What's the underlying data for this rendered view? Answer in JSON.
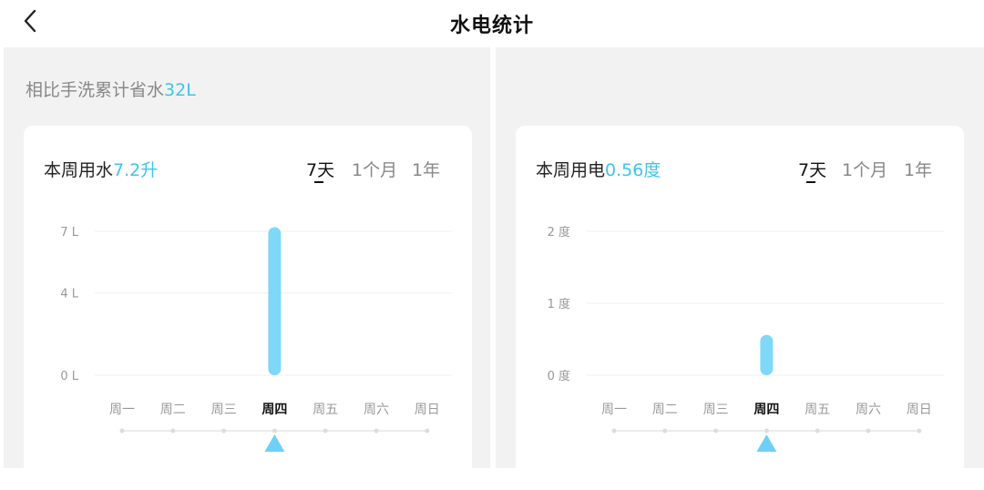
{
  "header": {
    "title": "水电统计",
    "back_icon": "chevron-left-icon"
  },
  "water": {
    "summary_prefix": "相比手洗累计省水",
    "summary_value": "32L",
    "card_title_prefix": "本周用水",
    "card_title_value": "7.2升",
    "ranges": [
      "7天",
      "1个月",
      "1年"
    ],
    "active_range": "7天"
  },
  "power": {
    "card_title_prefix": "本周用电",
    "card_title_value": "0.56度",
    "ranges": [
      "7天",
      "1个月",
      "1年"
    ],
    "active_range": "7天"
  },
  "colors": {
    "accent": "#3fc4e8",
    "bar": "#7fd8f7",
    "indicator": "#6fd0f5"
  },
  "chart_data": [
    {
      "type": "bar",
      "categories": [
        "周一",
        "周二",
        "周三",
        "周四",
        "周五",
        "周六",
        "周日"
      ],
      "values": [
        0,
        0,
        0,
        7.2,
        0,
        0,
        0
      ],
      "yticks": [
        "7 L",
        "4 L",
        "0 L"
      ],
      "ytick_values": [
        7,
        4,
        0
      ],
      "ylim": [
        0,
        7
      ],
      "selected_index": 3
    },
    {
      "type": "bar",
      "categories": [
        "周一",
        "周二",
        "周三",
        "周四",
        "周五",
        "周六",
        "周日"
      ],
      "values": [
        0,
        0,
        0,
        0.56,
        0,
        0,
        0
      ],
      "yticks": [
        "2 度",
        "1 度",
        "0 度"
      ],
      "ytick_values": [
        2,
        1,
        0
      ],
      "ylim": [
        0,
        2
      ],
      "selected_index": 3
    }
  ]
}
